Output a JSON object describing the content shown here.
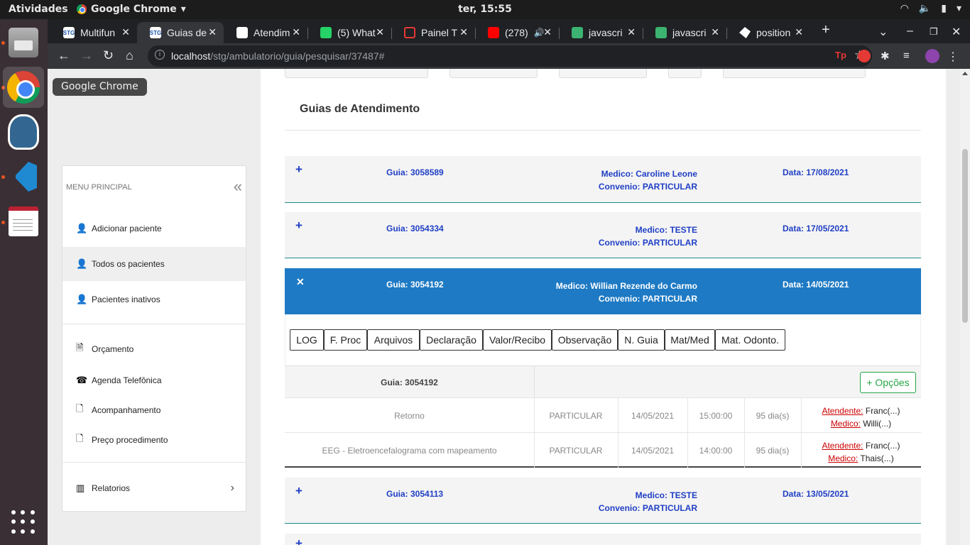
{
  "desktop": {
    "activities": "Atividades",
    "app_name": "Google Chrome",
    "clock": "ter, 15:55"
  },
  "dock": {
    "tooltip": "Google Chrome"
  },
  "browser": {
    "tabs": [
      {
        "title": "Multifun",
        "favicon": "stg-icon"
      },
      {
        "title": "Guias de",
        "favicon": "stg-icon"
      },
      {
        "title": "Atendim",
        "favicon": "globe-icon"
      },
      {
        "title": "(5) What",
        "favicon": "whatsapp-icon"
      },
      {
        "title": "Painel T",
        "favicon": "painel-icon"
      },
      {
        "title": "(278)",
        "favicon": "youtube-icon"
      },
      {
        "title": "javascri",
        "favicon": "stackoverflow-icon"
      },
      {
        "title": "javascri",
        "favicon": "stackoverflow-icon"
      },
      {
        "title": "position",
        "favicon": "position-icon"
      }
    ],
    "url_host": "localhost",
    "url_path": "/stg/ambulatorio/guia/pesquisar/37487#"
  },
  "sidebar": {
    "header": "MENU PRINCIPAL",
    "items": [
      {
        "label": "Adicionar paciente"
      },
      {
        "label": "Todos os pacientes"
      },
      {
        "label": "Pacientes inativos"
      },
      {
        "label": "Orçamento"
      },
      {
        "label": "Agenda Telefônica"
      },
      {
        "label": "Acompanhamento"
      },
      {
        "label": "Preço procedimento"
      },
      {
        "label": "Relatorios"
      }
    ]
  },
  "main": {
    "title": "Guias de Atendimento",
    "guias": [
      {
        "guia": "Guia: 3058589",
        "medico": "Medico: Caroline Leone",
        "convenio": "Convenio: PARTICULAR",
        "data": "Data: 17/08/2021"
      },
      {
        "guia": "Guia: 3054334",
        "medico": "Medico: TESTE",
        "convenio": "Convenio: PARTICULAR",
        "data": "Data: 17/05/2021"
      },
      {
        "guia": "Guia: 3054192",
        "medico": "Medico: Willian Rezende do Carmo",
        "convenio": "Convenio: PARTICULAR",
        "data": "Data: 14/05/2021"
      },
      {
        "guia": "Guia: 3054113",
        "medico": "Medico: TESTE",
        "convenio": "Convenio: PARTICULAR",
        "data": "Data: 13/05/2021"
      }
    ],
    "buttons": [
      "LOG",
      "F. Proc",
      "Arquivos",
      "Declaração",
      "Valor/Recibo",
      "Observação",
      "N. Guia",
      "Mat/Med",
      "Mat. Odonto."
    ],
    "detail": {
      "guia_label": "Guia: 3054192",
      "opcoes": "+ Opções",
      "atendente_label": "Atendente:",
      "medico_label": "Medico:",
      "rows": [
        {
          "procedimento": "Retorno",
          "convenio": "PARTICULAR",
          "data": "14/05/2021",
          "hora": "15:00:00",
          "dias": "95 dia(s)",
          "atendente": "Franc(...)",
          "medico": "Willi(...)"
        },
        {
          "procedimento": "EEG - Eletroencefalograma com mapeamento",
          "convenio": "PARTICULAR",
          "data": "14/05/2021",
          "hora": "14:00:00",
          "dias": "95 dia(s)",
          "atendente": "Franc(...)",
          "medico": "Thais(...)"
        }
      ]
    }
  }
}
